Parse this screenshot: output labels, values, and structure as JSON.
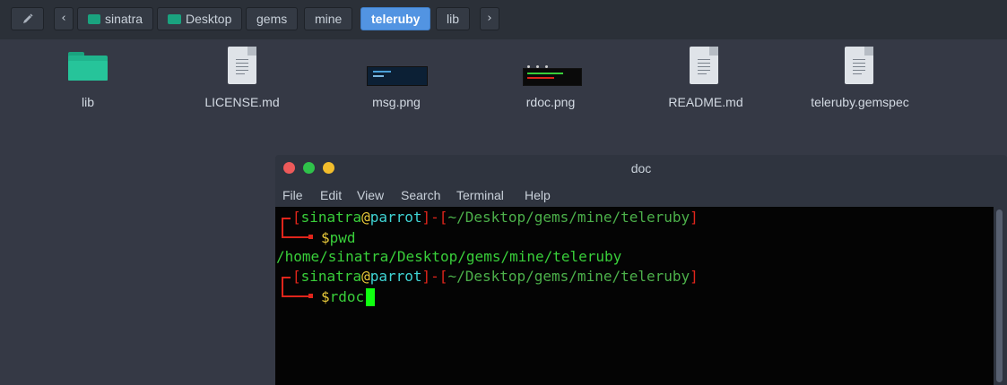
{
  "toolbar": {
    "breadcrumbs": [
      "sinatra",
      "Desktop",
      "gems",
      "mine",
      "teleruby",
      "lib"
    ],
    "active": "teleruby"
  },
  "files": [
    {
      "name": "lib",
      "type": "folder"
    },
    {
      "name": "LICENSE.md",
      "type": "text"
    },
    {
      "name": "msg.png",
      "type": "image"
    },
    {
      "name": "rdoc.png",
      "type": "image"
    },
    {
      "name": "README.md",
      "type": "text"
    },
    {
      "name": "teleruby.gemspec",
      "type": "text"
    }
  ],
  "terminal": {
    "title": "doc",
    "menu": [
      "File",
      "Edit",
      "View",
      "Search",
      "Terminal",
      "Help"
    ],
    "prompt": {
      "user": "sinatra",
      "at": "@",
      "host": "parrot",
      "dash": "-",
      "path": "~/Desktop/gems/mine/teleruby",
      "open": "[",
      "close": "]",
      "dollar": "$"
    },
    "cmd1": "pwd",
    "output1": "/home/sinatra/Desktop/gems/mine/teleruby",
    "cmd2": "rdoc"
  },
  "colors": {
    "accent": "#5294e2",
    "folder": "#20b48d",
    "prompt_red": "#e0251b",
    "prompt_green": "#39cf3a",
    "host_cyan": "#3fd4d4",
    "at_yellow": "#e8c93a"
  }
}
